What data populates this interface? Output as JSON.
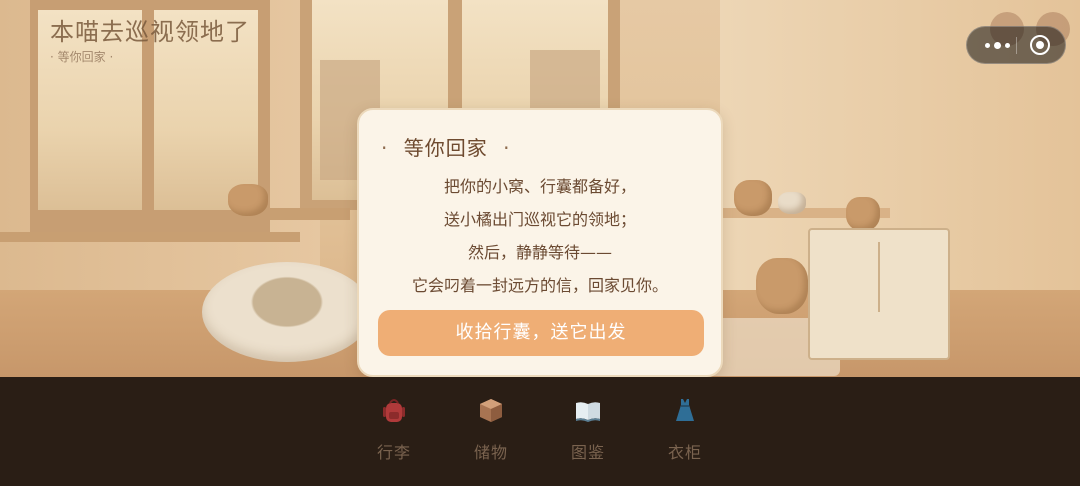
{
  "header": {
    "title": "本喵去巡视领地了",
    "subtitle": "· 等你回家 ·"
  },
  "dialog": {
    "heading_dot_left": "·",
    "heading": "等你回家",
    "heading_dot_right": "·",
    "lines": [
      "把你的小窝、行囊都备好，",
      "送小橘出门巡视它的领地；",
      "然后，静静等待——",
      "它会叼着一封远方的信，回家见你。"
    ],
    "cta_label": "收拾行囊，送它出发"
  },
  "nav": {
    "items": [
      {
        "label": "行李",
        "icon": "backpack-icon"
      },
      {
        "label": "储物",
        "icon": "box-icon"
      },
      {
        "label": "图鉴",
        "icon": "book-icon"
      },
      {
        "label": "衣柜",
        "icon": "dress-icon"
      }
    ]
  },
  "capsule": {
    "more_icon": "more-dots-icon",
    "close_icon": "close-target-icon"
  },
  "colors": {
    "accent": "#efae75",
    "dialog_bg": "#fbf4e8",
    "nav_bg": "#2a1e15"
  }
}
